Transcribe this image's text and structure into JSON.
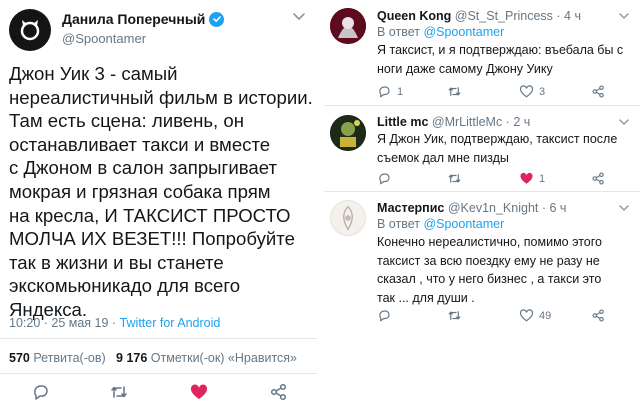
{
  "main_tweet": {
    "author_name": "Данила Поперечный",
    "author_handle": "@Spoontamer",
    "text": "Джон Уик 3 - самый\nнереалистичный фильм в истории.\nТам есть сцена: ливень, он\nостанавливает такси и вместе\nс Джоном в салон запрыгивает\nмокрая и грязная собака прям\nна кресла, И ТАКСИСТ ПРОСТО\nМОЛЧА ИХ ВЕЗЕТ!!! Попробуйте\nтак в жизни и вы станете\nэкскомьюникадо для всего\nЯндекса.",
    "timestamp": "10:20 · 25 мая 19 · ",
    "client": "Twitter for Android",
    "retweets_count": "570",
    "retweets_label": " Ретвита(-ов)",
    "likes_count": "9 176",
    "likes_label": " Отметки(-ок) «Нравится»",
    "icons": [
      "reply-icon",
      "retweet-icon",
      "like-icon",
      "share-icon"
    ],
    "like_color": "#e0245e"
  },
  "replies": [
    {
      "name": "Queen Kong",
      "handle": " @St_St_Princess · 4 ч",
      "in_reply_label": "В ответ ",
      "in_reply_handle": "@Spoontamer",
      "text": "Я таксист, и я подтверждаю: въебала бы с\nноги даже самому Джону Уику",
      "reply_count": "1",
      "retweet_count": "",
      "like_count": "3"
    },
    {
      "name": "Little mc",
      "handle": " @MrLittleMc · 2 ч",
      "text": "Я Джон Уик, подтверждаю, таксист после\nсъемок дал мне пизды",
      "reply_count": "",
      "retweet_count": "",
      "like_count": "1",
      "liked": true
    },
    {
      "name": "Мастерпис",
      "handle": " @Kev1n_Knight · 6 ч",
      "in_reply_label": "В ответ ",
      "in_reply_handle": "@Spoontamer",
      "text": "Конечно нереалистично, помимо этого\nтаксист за всю поездку ему не разу не\nсказал , что у него бизнес , а такси это\nтак ... для души .",
      "reply_count": "",
      "retweet_count": "",
      "like_count": "49"
    }
  ],
  "colors": {
    "link": "#1da1f2",
    "secondary_text": "#657786",
    "like": "#e0245e",
    "divider": "#e1e8ed"
  }
}
